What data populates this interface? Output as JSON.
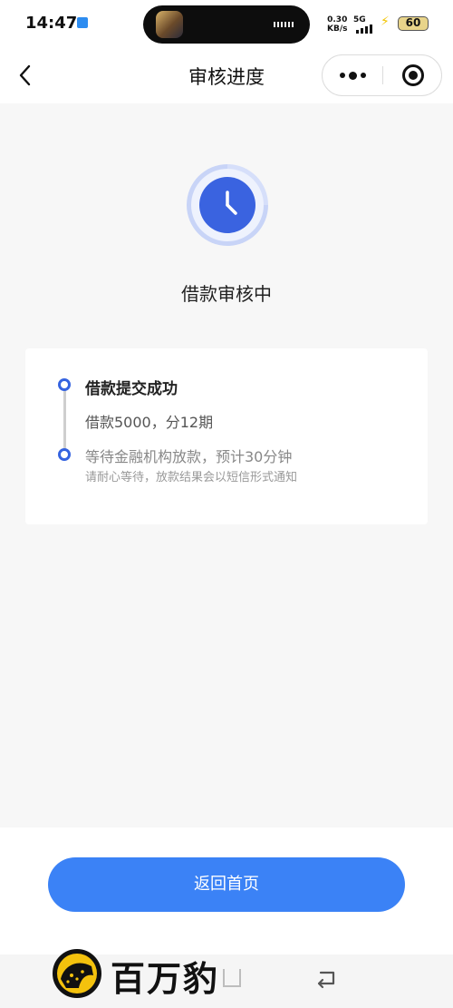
{
  "status_bar": {
    "time": "14:47",
    "net_speed_value": "0.30",
    "net_speed_unit": "KB/s",
    "network_type": "5G",
    "battery_level": "60"
  },
  "navbar": {
    "title": "审核进度"
  },
  "status": {
    "icon": "clock-icon",
    "text": "借款审核中"
  },
  "progress": {
    "steps": [
      {
        "title": "借款提交成功",
        "detail": "借款5000，分12期"
      },
      {
        "title": "等待金融机构放款，预计30分钟",
        "note": "请耐心等待，放款结果会以短信形式通知"
      }
    ]
  },
  "actions": {
    "home_button": "返回首页"
  },
  "watermark": {
    "text": "百万豹"
  },
  "colors": {
    "accent": "#3563e0",
    "button": "#3b82f6",
    "background": "#f7f7f7"
  }
}
